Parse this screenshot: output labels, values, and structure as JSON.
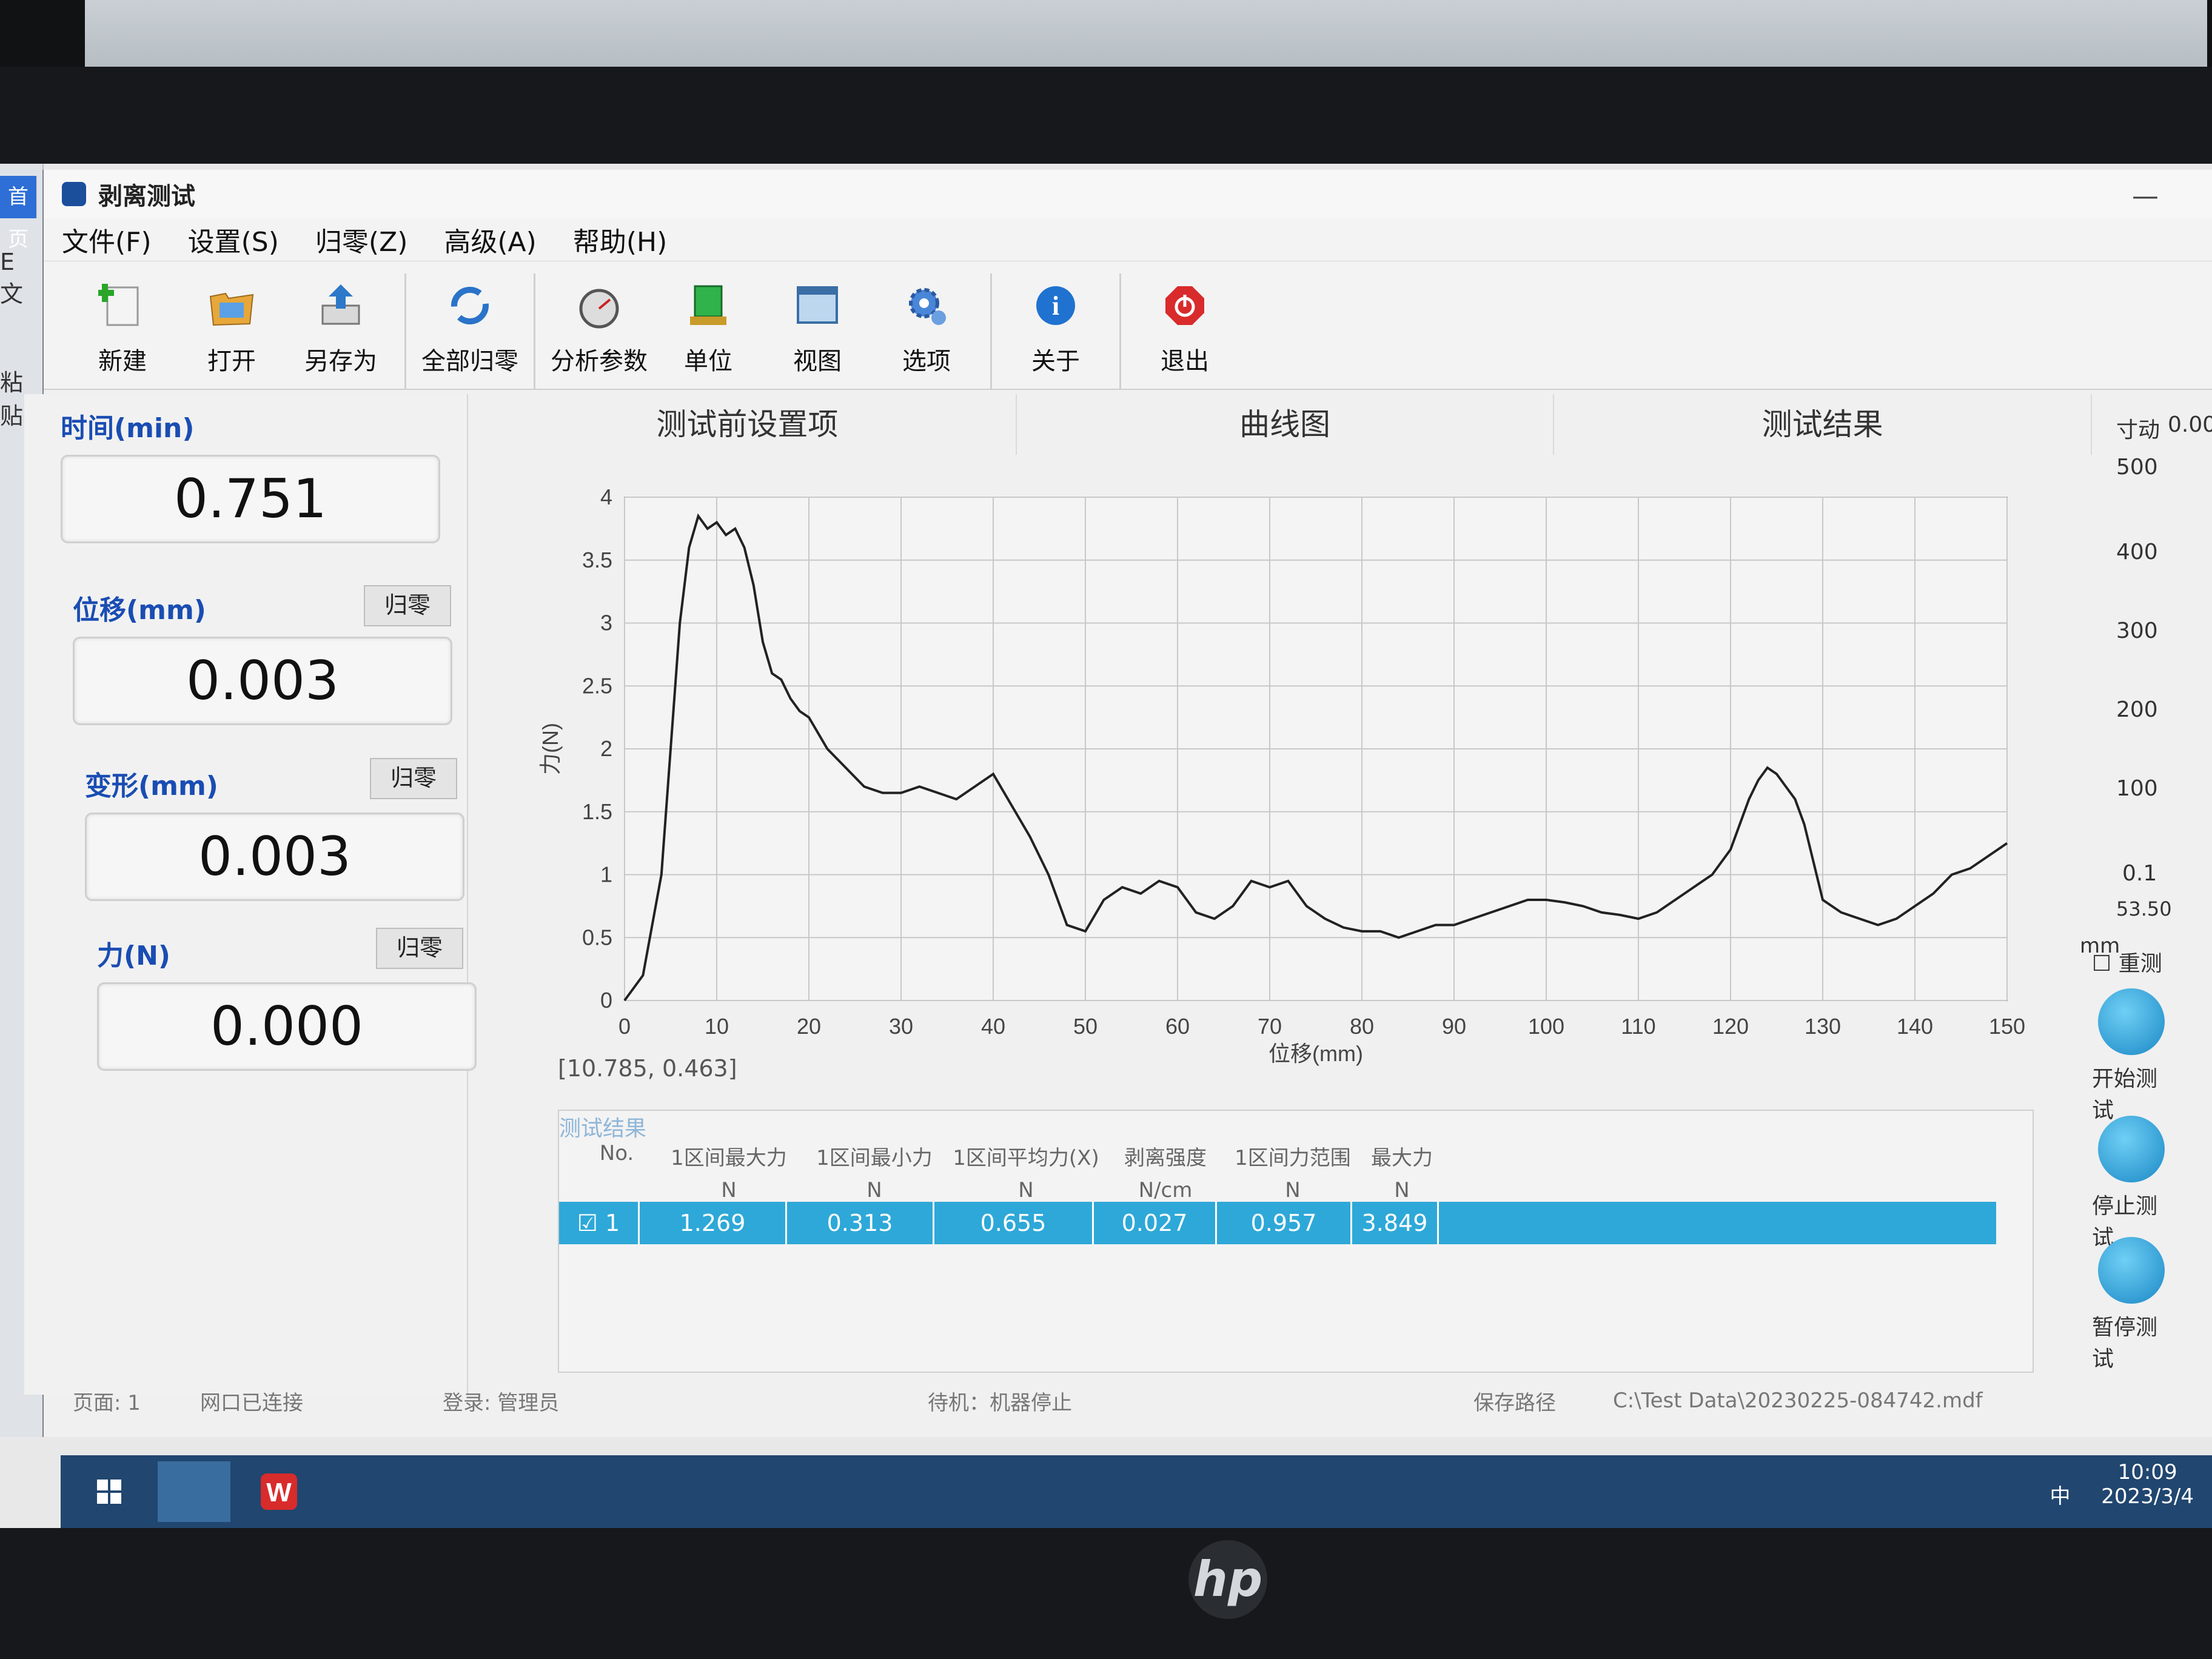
{
  "window": {
    "title": "剥离测试"
  },
  "desktop": {
    "tab_label": "首页",
    "side_texts": [
      "E 文",
      "粘贴"
    ]
  },
  "menu": [
    "文件(F)",
    "设置(S)",
    "归零(Z)",
    "高级(A)",
    "帮助(H)"
  ],
  "toolbar": [
    {
      "label": "新建",
      "icon": "new-file-icon"
    },
    {
      "label": "打开",
      "icon": "open-folder-icon"
    },
    {
      "label": "另存为",
      "icon": "save-as-icon"
    },
    {
      "label": "全部归零",
      "icon": "refresh-icon"
    },
    {
      "label": "分析参数",
      "icon": "gauge-icon"
    },
    {
      "label": "单位",
      "icon": "unit-icon"
    },
    {
      "label": "视图",
      "icon": "view-icon"
    },
    {
      "label": "选项",
      "icon": "gear-icon"
    },
    {
      "label": "关于",
      "icon": "info-icon"
    },
    {
      "label": "退出",
      "icon": "power-icon"
    }
  ],
  "readouts": {
    "time": {
      "label": "时间(min)",
      "value": "0.751"
    },
    "displacement": {
      "label": "位移(mm)",
      "value": "0.003",
      "zero": "归零"
    },
    "deformation": {
      "label": "变形(mm)",
      "value": "0.003",
      "zero": "归零"
    },
    "force": {
      "label": "力(N)",
      "value": "0.000",
      "zero": "归零"
    }
  },
  "tabs": [
    "测试前设置项",
    "曲线图",
    "测试结果"
  ],
  "chart_data": {
    "type": "line",
    "xlabel": "位移(mm)",
    "ylabel": "力(N)",
    "xlim": [
      0,
      150
    ],
    "ylim": [
      0,
      4
    ],
    "xticks": [
      "0",
      "10",
      "20",
      "30",
      "40",
      "50",
      "60",
      "70",
      "80",
      "90",
      "100",
      "110",
      "120",
      "130",
      "140",
      "150"
    ],
    "yticks": [
      "0",
      "0.5",
      "1",
      "1.5",
      "2",
      "2.5",
      "3",
      "3.5",
      "4"
    ],
    "grid": true,
    "x": [
      0,
      2,
      4,
      5,
      6,
      7,
      8,
      9,
      10,
      11,
      12,
      13,
      14,
      15,
      16,
      17,
      18,
      19,
      20,
      22,
      24,
      26,
      28,
      30,
      32,
      34,
      36,
      38,
      40,
      42,
      44,
      46,
      48,
      50,
      52,
      54,
      56,
      58,
      60,
      62,
      64,
      66,
      68,
      70,
      72,
      74,
      76,
      78,
      80,
      82,
      84,
      86,
      88,
      90,
      92,
      94,
      96,
      98,
      100,
      102,
      104,
      106,
      108,
      110,
      112,
      114,
      116,
      118,
      120,
      121,
      122,
      123,
      124,
      125,
      126,
      127,
      128,
      129,
      130,
      132,
      134,
      136,
      138,
      140,
      142,
      144,
      146,
      148,
      150
    ],
    "y": [
      0,
      0.2,
      1.0,
      2.0,
      3.0,
      3.6,
      3.85,
      3.75,
      3.8,
      3.7,
      3.75,
      3.6,
      3.3,
      2.85,
      2.6,
      2.55,
      2.4,
      2.3,
      2.25,
      2.0,
      1.85,
      1.7,
      1.65,
      1.65,
      1.7,
      1.65,
      1.6,
      1.7,
      1.8,
      1.55,
      1.3,
      1.0,
      0.6,
      0.55,
      0.8,
      0.9,
      0.85,
      0.95,
      0.9,
      0.7,
      0.65,
      0.75,
      0.95,
      0.9,
      0.95,
      0.75,
      0.65,
      0.58,
      0.55,
      0.55,
      0.5,
      0.55,
      0.6,
      0.6,
      0.65,
      0.7,
      0.75,
      0.8,
      0.8,
      0.78,
      0.75,
      0.7,
      0.68,
      0.65,
      0.7,
      0.8,
      0.9,
      1.0,
      1.2,
      1.4,
      1.6,
      1.75,
      1.85,
      1.8,
      1.7,
      1.6,
      1.4,
      1.1,
      0.8,
      0.7,
      0.65,
      0.6,
      0.65,
      0.75,
      0.85,
      1.0,
      1.05,
      1.15,
      1.25
    ],
    "cursor_readout": "[10.785, 0.463]"
  },
  "results": {
    "title": "测试结果",
    "headers": [
      {
        "name": "No.",
        "unit": ""
      },
      {
        "name": "1区间最大力",
        "unit": "N"
      },
      {
        "name": "1区间最小力",
        "unit": "N"
      },
      {
        "name": "1区间平均力(X)",
        "unit": "N"
      },
      {
        "name": "剥离强度",
        "unit": "N/cm"
      },
      {
        "name": "1区间力范围",
        "unit": "N"
      },
      {
        "name": "最大力",
        "unit": "N"
      }
    ],
    "rows": [
      {
        "no": "1",
        "max": "1.269",
        "min": "0.313",
        "avg": "0.655",
        "strength": "0.027",
        "range": "0.957",
        "peak": "3.849"
      }
    ]
  },
  "right_panel": {
    "jog_label": "寸动",
    "jog_value": "0.00",
    "scale": [
      "500",
      "400",
      "300",
      "200",
      "100"
    ],
    "min_label": "0.1",
    "position": "53.50",
    "unit": "mm",
    "retest": "重测",
    "start": "开始测试",
    "stop": "停止测试",
    "pause": "暂停测试"
  },
  "status": {
    "page": "页面: 1",
    "port": "网口已连接",
    "login": "登录: 管理员",
    "state": "待机：机器停止",
    "save_label": "保存路径",
    "save_path": "C:\\Test Data\\20230225-084742.mdf"
  },
  "taskbar": {
    "time": "10:09",
    "date": "2023/3/4",
    "ime": "中"
  },
  "brand": "hp"
}
